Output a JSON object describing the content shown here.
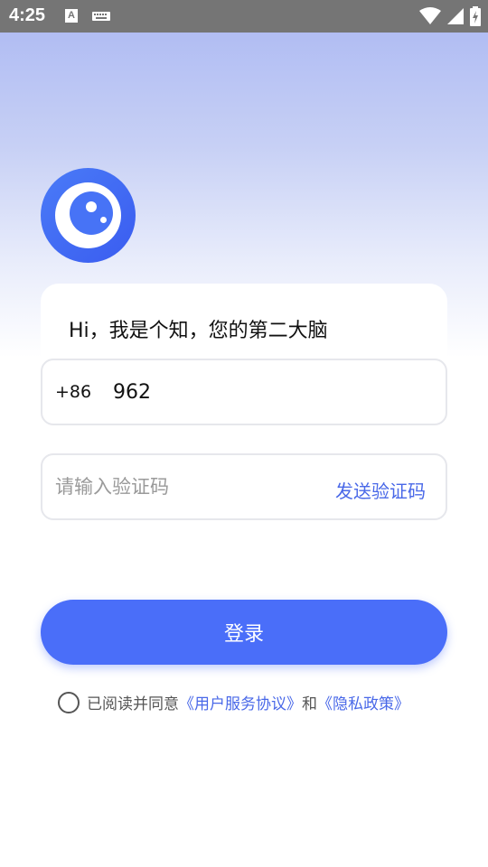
{
  "status_bar": {
    "time": "4:25",
    "icons": [
      "a-notification-icon",
      "keyboard-icon",
      "wifi-icon",
      "cellular-signal-icon",
      "battery-charging-icon"
    ]
  },
  "logo": {
    "icon": "eye-logo-icon"
  },
  "greeting": "Hi，我是个知，您的第二大脑",
  "phone": {
    "country_code": "+86",
    "value": "962"
  },
  "verification": {
    "placeholder": "请输入验证码",
    "send_label": "发送验证码"
  },
  "login_label": "登录",
  "agreement": {
    "prefix": "已阅读并同意",
    "terms": "《用户服务协议》",
    "and": "和",
    "privacy": "《隐私政策》"
  },
  "colors": {
    "accent": "#4a6ef9",
    "link": "#4968e8",
    "status_bar": "#757575"
  }
}
